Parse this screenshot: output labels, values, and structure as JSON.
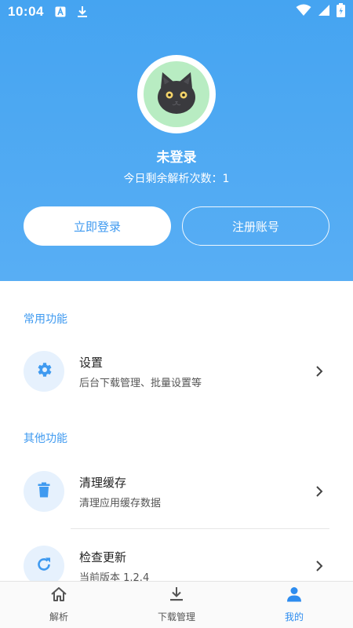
{
  "status_bar": {
    "time": "10:04"
  },
  "profile": {
    "username": "未登录",
    "quota_text": "今日剩余解析次数：1",
    "login_label": "立即登录",
    "register_label": "注册账号"
  },
  "sections": [
    {
      "title": "常用功能",
      "items": [
        {
          "title": "设置",
          "subtitle": "后台下载管理、批量设置等",
          "icon": "gear-icon"
        }
      ]
    },
    {
      "title": "其他功能",
      "items": [
        {
          "title": "清理缓存",
          "subtitle": "清理应用缓存数据",
          "icon": "trash-icon"
        },
        {
          "title": "检查更新",
          "subtitle": "当前版本 1.2.4",
          "icon": "refresh-icon"
        }
      ]
    }
  ],
  "bottom_nav": [
    {
      "label": "解析",
      "icon": "home-icon",
      "active": false
    },
    {
      "label": "下载管理",
      "icon": "download-icon",
      "active": false
    },
    {
      "label": "我的",
      "icon": "person-icon",
      "active": true
    }
  ],
  "colors": {
    "accent": "#3f9af0",
    "header": "#4aa7f2",
    "icon_bg": "#e6f1fd"
  }
}
